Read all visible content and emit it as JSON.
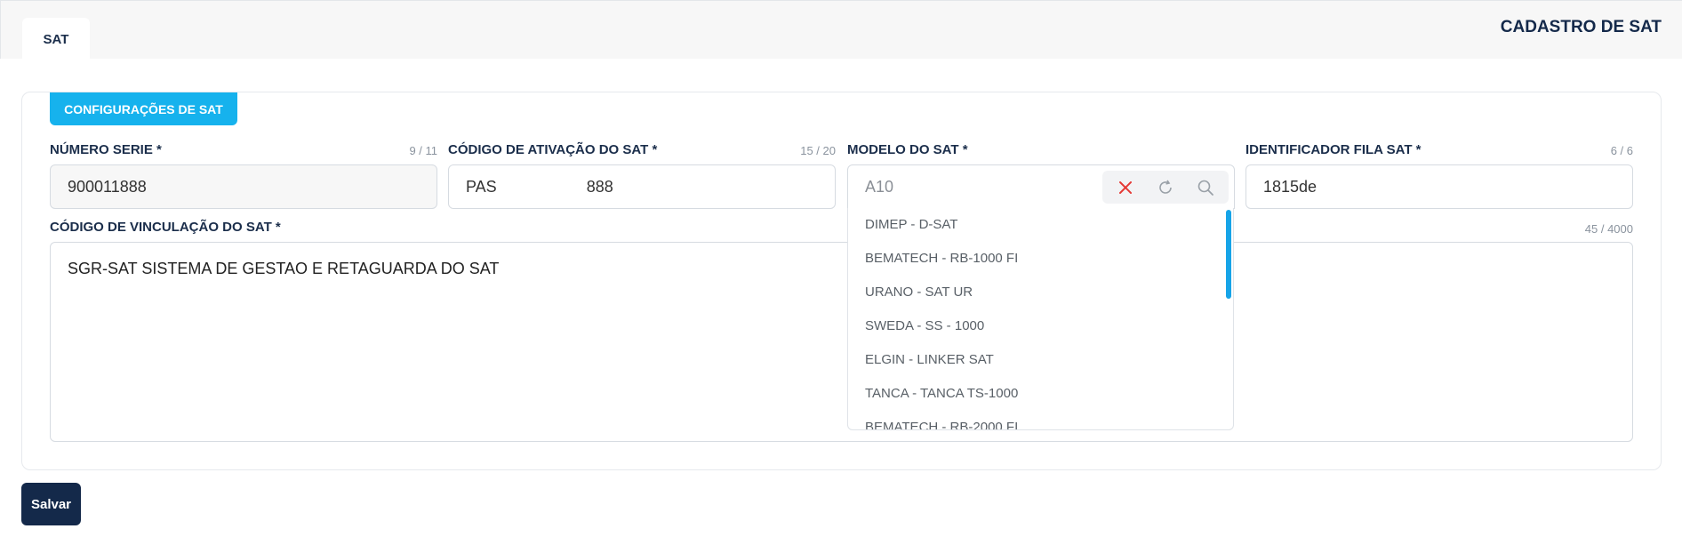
{
  "header": {
    "tab_label": "SAT",
    "page_title": "CADASTRO DE SAT"
  },
  "section": {
    "title": "CONFIGURAÇÕES DE SAT"
  },
  "fields": {
    "numero_serie": {
      "label": "NÚMERO SERIE *",
      "counter": "9 / 11",
      "value": "900011888"
    },
    "codigo_ativacao": {
      "label": "CÓDIGO DE ATIVAÇÃO DO SAT *",
      "counter": "15 / 20",
      "value_start": "PAS",
      "value_end": "888"
    },
    "modelo_sat": {
      "label": "MODELO DO SAT *",
      "placeholder": "A10"
    },
    "identificador_fila": {
      "label": "IDENTIFICADOR FILA SAT *",
      "counter": "6 / 6",
      "value": "1815de"
    },
    "codigo_vinculacao": {
      "label": "CÓDIGO DE VINCULAÇÃO DO SAT *",
      "counter": "45 / 4000",
      "value": "SGR-SAT SISTEMA DE GESTAO E RETAGUARDA DO SAT"
    }
  },
  "dropdown": {
    "options": [
      "DIMEP - D-SAT",
      "BEMATECH - RB-1000 FI",
      "URANO - SAT UR",
      "SWEDA - SS - 1000",
      "ELGIN - LINKER SAT",
      "TANCA - TANCA TS-1000",
      "BEMATECH - RB-2000 FI"
    ]
  },
  "icons": {
    "clear": "close-icon",
    "refresh": "refresh-icon",
    "search": "search-icon"
  },
  "colors": {
    "accent": "#16b2ed",
    "primary": "#14294a",
    "danger": "#e53935"
  },
  "footer": {
    "save_label": "Salvar"
  }
}
